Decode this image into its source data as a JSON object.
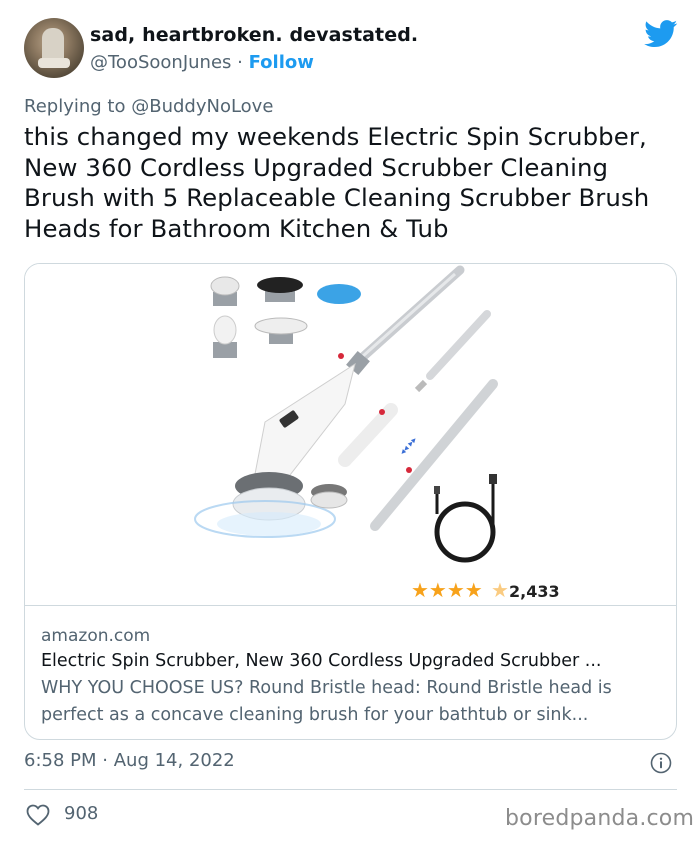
{
  "tweet": {
    "display_name": "sad, heartbroken. devastated.",
    "handle": "@TooSoonJunes",
    "separator": "·",
    "follow_label": "Follow",
    "replying_prefix": "Replying to",
    "replying_user": "@BuddyNoLove",
    "text": "this changed my weekends Electric Spin Scrubber, New 360 Cordless Upgraded Scrubber Cleaning Brush with 5 Replaceable Cleaning Scrubber Brush Heads for Bathroom Kitchen & Tub",
    "time": "6:58 PM",
    "date_separator": "·",
    "date": "Aug 14, 2022",
    "like_count": "908"
  },
  "card": {
    "rating_stars": 4.5,
    "rating_count": "2,433",
    "domain": "amazon.com",
    "title": "Electric Spin Scrubber, New 360 Cordless Upgraded Scrubber ...",
    "description": "WHY YOU CHOOSE US? Round Bristle head: Round Bristle head is perfect as a concave cleaning brush for your bathtub or sink..."
  },
  "watermark": "boredpanda.com",
  "colors": {
    "accent": "#1d9bf0",
    "secondary_text": "#536471",
    "border": "#cfd9de",
    "star": "#f7a21b"
  },
  "icons": {
    "brand": "twitter-bird-icon",
    "info": "info-icon",
    "like": "heart-outline-icon"
  }
}
